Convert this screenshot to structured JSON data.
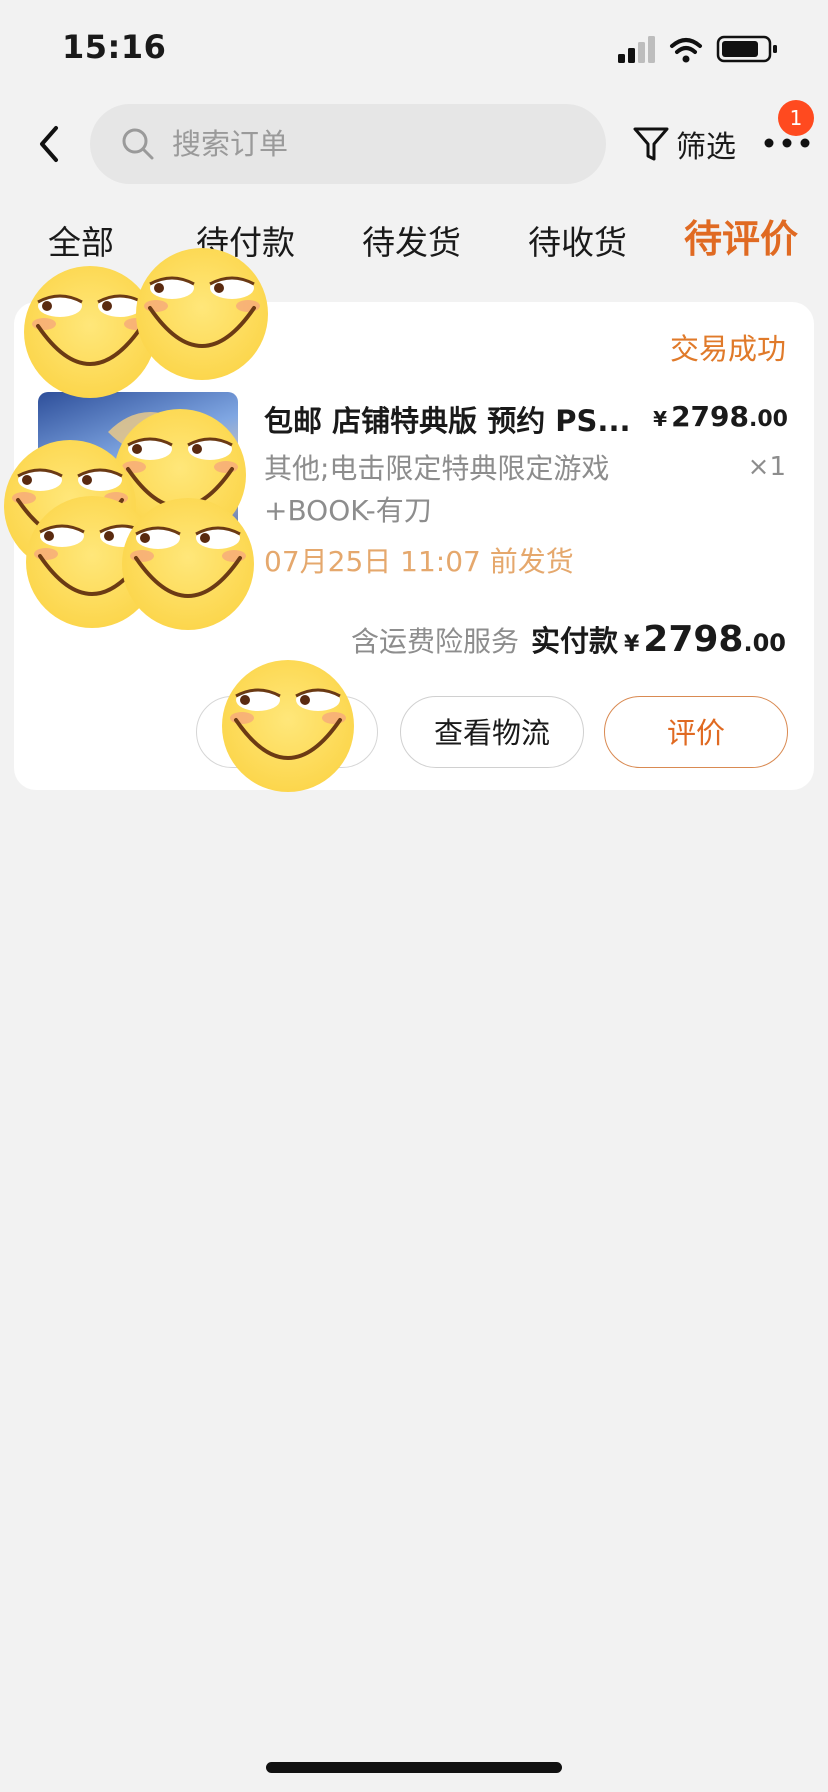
{
  "status_bar": {
    "time": "15:16"
  },
  "header": {
    "search": {
      "placeholder": "搜索订单"
    },
    "filter_label": "筛选",
    "more_badge": "1"
  },
  "tabs": [
    {
      "label": "全部",
      "active": false
    },
    {
      "label": "待付款",
      "active": false
    },
    {
      "label": "待发货",
      "active": false
    },
    {
      "label": "待收货",
      "active": false
    },
    {
      "label": "待评价",
      "active": true
    }
  ],
  "order": {
    "status": "交易成功",
    "product_title": "包邮 店铺特典版 预约 PS...",
    "unit_price": {
      "currency": "¥",
      "integer": "2798",
      "decimal": ".00"
    },
    "sku_line1": "其他;电击限定特典限定游戏",
    "sku_line2": "+BOOK-有刀",
    "quantity": "×1",
    "ship_time": "07月25日 11:07 前发货",
    "insurance": "含运费险服务",
    "paid_label": "实付款",
    "paid": {
      "currency": "¥",
      "integer": "2798",
      "decimal": ".00"
    },
    "buttons": {
      "more": "",
      "logistics": "查看物流",
      "review": "评价"
    }
  },
  "colors": {
    "accent": "#e06a22",
    "status_orange": "#e07a2a",
    "ship_time": "#e5a86d",
    "badge": "#ff4a1f",
    "background": "#f2f2f2"
  },
  "icons": [
    "back-arrow-icon",
    "search-icon",
    "filter-funnel-icon",
    "more-dots-icon",
    "smiley-sticker-icon"
  ]
}
